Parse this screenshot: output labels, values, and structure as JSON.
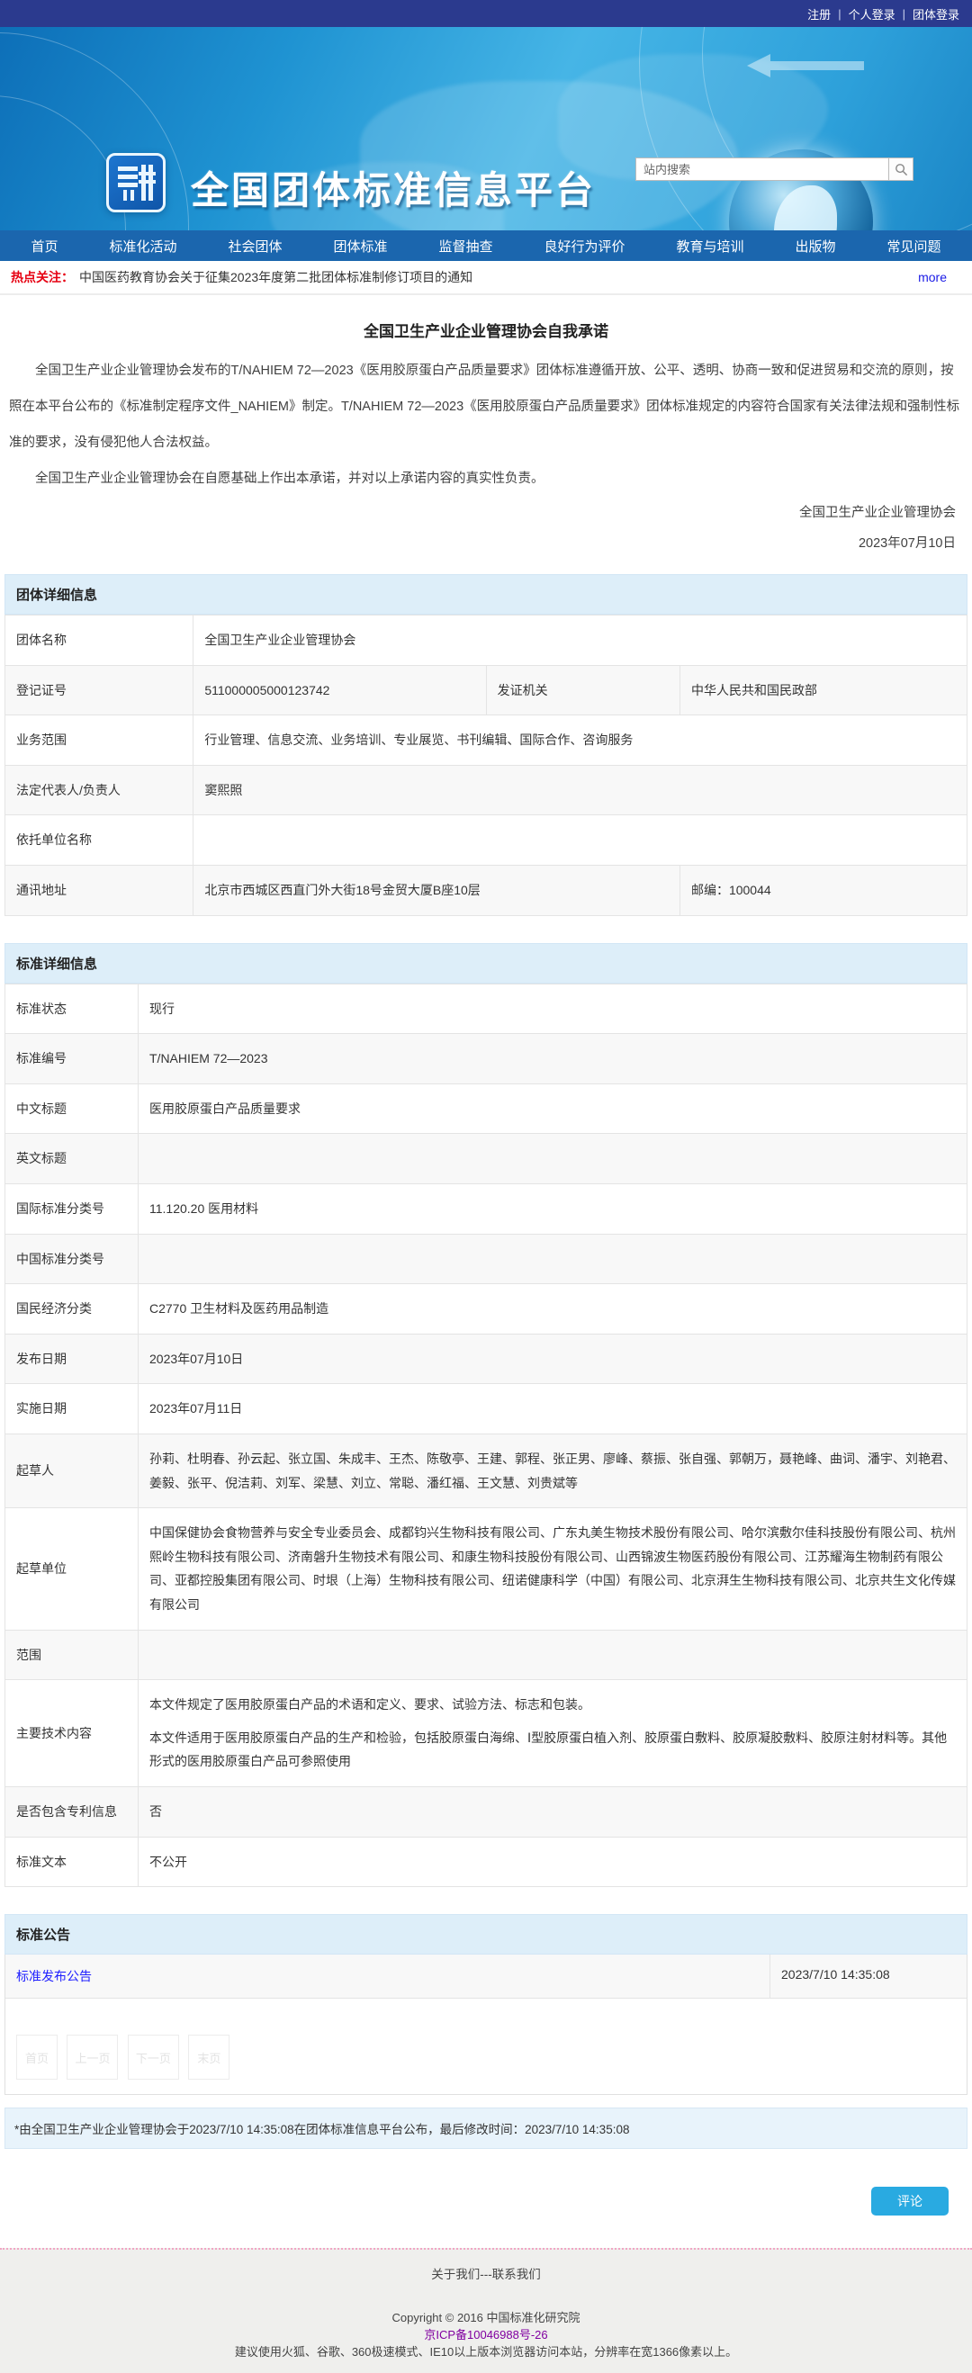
{
  "colors": {
    "topbar_bg": "#2b3a8e",
    "nav_bg": "#1b66ae",
    "banner_blue": "#1f93d2",
    "section_head_bg": "#ddeef9",
    "hot_red": "#e60012",
    "link_blue": "#2020ff",
    "comment_btn": "#29aae1",
    "icp_purple": "#8000a0",
    "footer_bg": "#efefed"
  },
  "topbar": {
    "separator": "|",
    "register": "注册",
    "personal_login": "个人登录",
    "group_login": "团体登录"
  },
  "banner": {
    "site_title": "全国团体标准信息平台",
    "search_placeholder": "站内搜索",
    "search_icon": "magnifier-icon",
    "logo_icon": "platform-logo-icon"
  },
  "nav": {
    "items": [
      "首页",
      "标准化活动",
      "社会团体",
      "团体标准",
      "监督抽查",
      "良好行为评价",
      "教育与培训",
      "出版物",
      "常见问题"
    ]
  },
  "hotline": {
    "label": "热点关注：",
    "notice": "中国医药教育协会关于征集2023年度第二批团体标准制修订项目的通知",
    "more": "more"
  },
  "promise": {
    "title": "全国卫生产业企业管理协会自我承诺",
    "paragraphs": [
      "全国卫生产业企业管理协会发布的T/NAHIEM 72—2023《医用胶原蛋白产品质量要求》团体标准遵循开放、公平、透明、协商一致和促进贸易和交流的原则，按照在本平台公布的《标准制定程序文件_NAHIEM》制定。T/NAHIEM 72—2023《医用胶原蛋白产品质量要求》团体标准规定的内容符合国家有关法律法规和强制性标准的要求，没有侵犯他人合法权益。",
      "全国卫生产业企业管理协会在自愿基础上作出本承诺，并对以上承诺内容的真实性负责。"
    ],
    "signer": "全国卫生产业企业管理协会",
    "date": "2023年07月10日"
  },
  "group_info": {
    "section_title": "团体详细信息",
    "name_label": "团体名称",
    "name": "全国卫生产业企业管理协会",
    "reg_no_label": "登记证号",
    "reg_no": "511000005000123742",
    "authority_label": "发证机关",
    "authority": "中华人民共和国民政部",
    "scope_label": "业务范围",
    "scope": "行业管理、信息交流、业务培训、专业展览、书刊编辑、国际合作、咨询服务",
    "legal_rep_label": "法定代表人/负责人",
    "legal_rep": "窦熙照",
    "rely_unit_label": "依托单位名称",
    "rely_unit": "",
    "address_label": "通讯地址",
    "address": "北京市西城区西直门外大街18号金贸大厦B座10层",
    "postcode": "邮编：100044"
  },
  "standard_info": {
    "section_title": "标准详细信息",
    "rows": [
      {
        "label": "标准状态",
        "value": "现行"
      },
      {
        "label": "标准编号",
        "value": "T/NAHIEM 72—2023"
      },
      {
        "label": "中文标题",
        "value": "医用胶原蛋白产品质量要求"
      },
      {
        "label": "英文标题",
        "value": ""
      },
      {
        "label": "国际标准分类号",
        "value": "11.120.20 医用材料"
      },
      {
        "label": "中国标准分类号",
        "value": ""
      },
      {
        "label": "国民经济分类",
        "value": "C2770 卫生材料及医药用品制造"
      },
      {
        "label": "发布日期",
        "value": "2023年07月10日"
      },
      {
        "label": "实施日期",
        "value": "2023年07月11日"
      },
      {
        "label": "起草人",
        "value": "孙莉、杜明春、孙云起、张立国、朱成丰、王杰、陈敬亭、王建、郭程、张正男、廖峰、蔡振、张自强、郭朝万，聂艳峰、曲词、潘宇、刘艳君、姜毅、张平、倪洁莉、刘军、梁慧、刘立、常聪、潘红福、王文慧、刘贵斌等"
      },
      {
        "label": "起草单位",
        "value": "中国保健协会食物营养与安全专业委员会、成都钧兴生物科技有限公司、广东丸美生物技术股份有限公司、哈尔滨敷尔佳科技股份有限公司、杭州熙岭生物科技有限公司、济南磐升生物技术有限公司、和康生物科技股份有限公司、山西锦波生物医药股份有限公司、江苏耀海生物制药有限公司、亚都控股集团有限公司、时垠（上海）生物科技有限公司、纽诺健康科学（中国）有限公司、北京湃生生物科技有限公司、北京共生文化传媒有限公司"
      },
      {
        "label": "范围",
        "value": ""
      },
      {
        "label": "主要技术内容",
        "value": "本文件规定了医用胶原蛋白产品的术语和定义、要求、试验方法、标志和包装。",
        "value2": "本文件适用于医用胶原蛋白产品的生产和检验，包括胶原蛋白海绵、Ⅰ型胶原蛋白植入剂、胶原蛋白敷料、胶原凝胶敷料、胶原注射材料等。其他形式的医用胶原蛋白产品可参照使用"
      },
      {
        "label": "是否包含专利信息",
        "value": "否"
      },
      {
        "label": "标准文本",
        "value": "不公开"
      }
    ]
  },
  "announcement": {
    "section_title": "标准公告",
    "items": [
      {
        "title": "标准发布公告",
        "time": "2023/7/10 14:35:08"
      }
    ],
    "pagination": [
      "首页",
      "上一页",
      "下一页",
      "末页"
    ]
  },
  "note": "*由全国卫生产业企业管理协会于2023/7/10 14:35:08在团体标准信息平台公布，最后修改时间：2023/7/10 14:35:08",
  "comment_button": "评论",
  "footer": {
    "about": "关于我们",
    "about_sep": "---",
    "contact": "联系我们",
    "copyright": "Copyright © 2016 中国标准化研究院",
    "icp": "京ICP备10046988号-26",
    "advice": "建议使用火狐、谷歌、360极速模式、IE10以上版本浏览器访问本站，分辨率在宽1366像素以上。"
  }
}
